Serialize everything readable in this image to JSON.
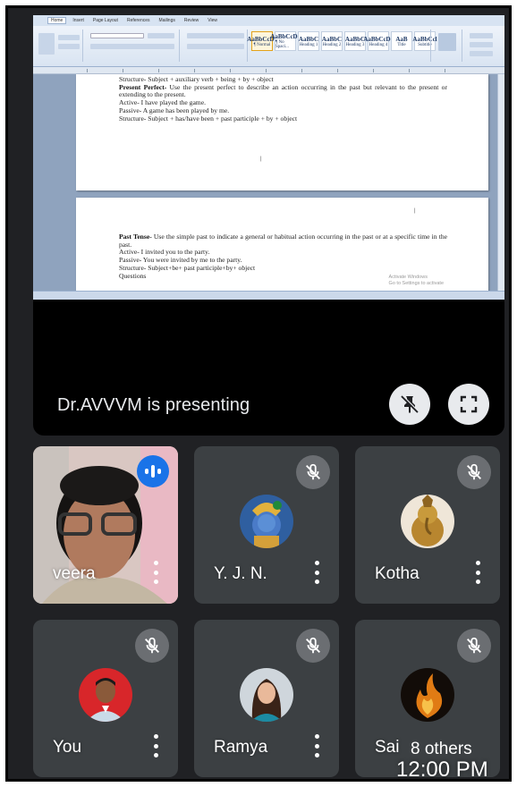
{
  "presentation": {
    "presenter_label": "Dr.AVVVM is presenting",
    "document": {
      "ribbon_tabs": [
        "Home",
        "Insert",
        "Page Layout",
        "References",
        "Mailings",
        "Review",
        "View"
      ],
      "styles": [
        {
          "sample": "AaBbCcDc",
          "name": "¶ Normal"
        },
        {
          "sample": "AaBbCcDc",
          "name": "¶ No Spaci..."
        },
        {
          "sample": "AaBbC",
          "name": "Heading 1"
        },
        {
          "sample": "AaBbC",
          "name": "Heading 2"
        },
        {
          "sample": "AaBbC",
          "name": "Heading 3"
        },
        {
          "sample": "AaBbCcDc",
          "name": "Heading 4"
        },
        {
          "sample": "AaB",
          "name": "Title"
        },
        {
          "sample": "AaBbCcl",
          "name": "Subtitle"
        }
      ],
      "page1_lines": [
        {
          "lead": "",
          "text": "Structure- Subject + auxiliary verb + being + by + object"
        },
        {
          "lead": "Present Perfect-",
          "text": " Use the present perfect to describe an action occurring in the past but relevant to the present or extending to the present."
        },
        {
          "lead": "",
          "text": "Active- I have played the game."
        },
        {
          "lead": "",
          "text": "Passive- A game has been played by me."
        },
        {
          "lead": "",
          "text": "Structure- Subject + has/have been + past participle + by + object"
        }
      ],
      "page2_lines": [
        {
          "lead": "Past Tense-",
          "text": " Use the simple past to indicate a general or habitual action occurring in the past or at a specific time in the past."
        },
        {
          "lead": "",
          "text": "Active- I invited you to the party."
        },
        {
          "lead": "",
          "text": "Passive- You were invited by me to the party."
        },
        {
          "lead": "",
          "text": "Structure- Subject+be+ past participle+by+ object"
        },
        {
          "lead": "",
          "text": "Questions"
        }
      ],
      "watermark_line1": "Activate Windows",
      "watermark_line2": "Go to Settings to activate"
    }
  },
  "participants": [
    {
      "name": "veera",
      "speaking": true,
      "muted": false,
      "avatar": "camera-video"
    },
    {
      "name": "Y. J. N.",
      "speaking": false,
      "muted": true,
      "avatar": "krishna-picture"
    },
    {
      "name": "Kotha",
      "speaking": false,
      "muted": true,
      "avatar": "ganesha-statue"
    },
    {
      "name": "You",
      "speaking": false,
      "muted": true,
      "avatar": "man-portrait"
    },
    {
      "name": "Ramya",
      "speaking": false,
      "muted": true,
      "avatar": "woman-portrait"
    },
    {
      "name": "Sai",
      "speaking": false,
      "muted": true,
      "avatar": "flame-picture",
      "overlay": "8 others"
    }
  ],
  "status": {
    "time": "12:00 PM"
  },
  "colors": {
    "background": "#202124",
    "tile": "#3c4043",
    "speaking_badge": "#1a73e8"
  }
}
